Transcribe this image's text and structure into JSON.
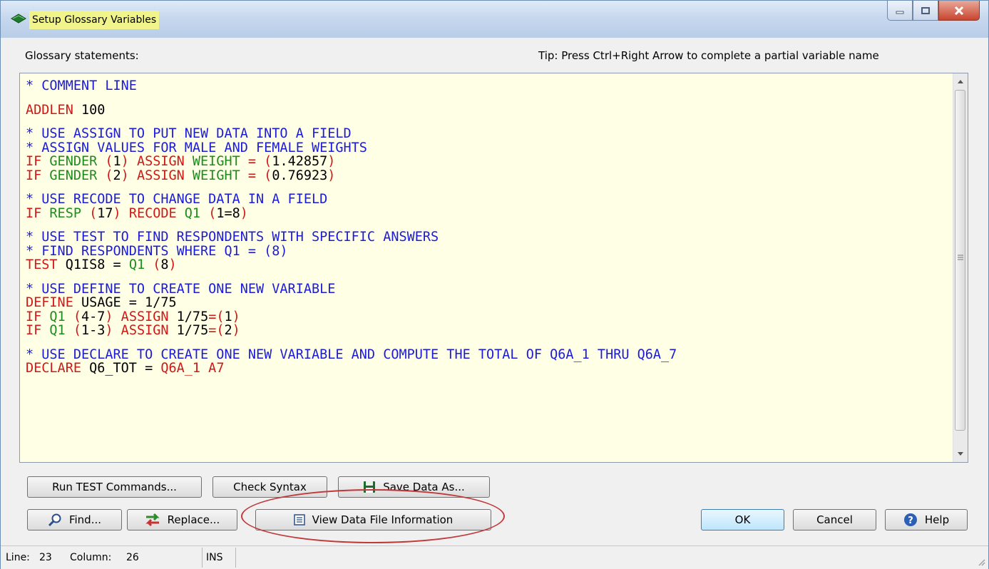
{
  "window": {
    "title": "Setup Glossary Variables",
    "title_highlight_color": "#f0f48a"
  },
  "labels": {
    "statements": "Glossary statements:",
    "tip": "Tip: Press Ctrl+Right Arrow to complete a partial variable name"
  },
  "code": {
    "lines": [
      [
        {
          "t": "* COMMENT LINE",
          "s": "c"
        }
      ],
      [],
      [
        {
          "t": "ADDLEN",
          "s": "k"
        },
        {
          "t": " 100",
          "s": "n"
        }
      ],
      [],
      [
        {
          "t": "* USE ASSIGN TO PUT NEW DATA INTO A FIELD",
          "s": "c"
        }
      ],
      [
        {
          "t": "* ASSIGN VALUES FOR MALE AND FEMALE WEIGHTS",
          "s": "c"
        }
      ],
      [
        {
          "t": "IF ",
          "s": "k"
        },
        {
          "t": "GENDER",
          "s": "v"
        },
        {
          "t": " (",
          "s": "k"
        },
        {
          "t": "1",
          "s": "n"
        },
        {
          "t": ") ASSIGN ",
          "s": "k"
        },
        {
          "t": "WEIGHT",
          "s": "v"
        },
        {
          "t": " = (",
          "s": "k"
        },
        {
          "t": "1.42857",
          "s": "n"
        },
        {
          "t": ")",
          "s": "k"
        }
      ],
      [
        {
          "t": "IF ",
          "s": "k"
        },
        {
          "t": "GENDER",
          "s": "v"
        },
        {
          "t": " (",
          "s": "k"
        },
        {
          "t": "2",
          "s": "n"
        },
        {
          "t": ") ASSIGN ",
          "s": "k"
        },
        {
          "t": "WEIGHT",
          "s": "v"
        },
        {
          "t": " = (",
          "s": "k"
        },
        {
          "t": "0.76923",
          "s": "n"
        },
        {
          "t": ")",
          "s": "k"
        }
      ],
      [],
      [
        {
          "t": "* USE RECODE TO CHANGE DATA IN A FIELD",
          "s": "c"
        }
      ],
      [
        {
          "t": "IF ",
          "s": "k"
        },
        {
          "t": "RESP",
          "s": "v"
        },
        {
          "t": " (",
          "s": "k"
        },
        {
          "t": "17",
          "s": "n"
        },
        {
          "t": ") RECODE ",
          "s": "k"
        },
        {
          "t": "Q1",
          "s": "v"
        },
        {
          "t": " (",
          "s": "k"
        },
        {
          "t": "1=8",
          "s": "n"
        },
        {
          "t": ")",
          "s": "k"
        }
      ],
      [],
      [
        {
          "t": "* USE TEST TO FIND RESPONDENTS WITH SPECIFIC ANSWERS",
          "s": "c"
        }
      ],
      [
        {
          "t": "* FIND RESPONDENTS WHERE Q1 = (8)",
          "s": "c"
        }
      ],
      [
        {
          "t": "TEST ",
          "s": "k"
        },
        {
          "t": "Q1IS8 = ",
          "s": "n"
        },
        {
          "t": "Q1",
          "s": "v"
        },
        {
          "t": " (",
          "s": "k"
        },
        {
          "t": "8",
          "s": "n"
        },
        {
          "t": ")",
          "s": "k"
        }
      ],
      [],
      [
        {
          "t": "* USE DEFINE TO CREATE ONE NEW VARIABLE",
          "s": "c"
        }
      ],
      [
        {
          "t": "DEFINE ",
          "s": "k"
        },
        {
          "t": "USAGE = 1/75",
          "s": "n"
        }
      ],
      [
        {
          "t": "IF ",
          "s": "k"
        },
        {
          "t": "Q1",
          "s": "v"
        },
        {
          "t": " (",
          "s": "k"
        },
        {
          "t": "4-7",
          "s": "n"
        },
        {
          "t": ") ASSIGN ",
          "s": "k"
        },
        {
          "t": "1/75",
          "s": "n"
        },
        {
          "t": "=(",
          "s": "k"
        },
        {
          "t": "1",
          "s": "n"
        },
        {
          "t": ")",
          "s": "k"
        }
      ],
      [
        {
          "t": "IF ",
          "s": "k"
        },
        {
          "t": "Q1",
          "s": "v"
        },
        {
          "t": " (",
          "s": "k"
        },
        {
          "t": "1-3",
          "s": "n"
        },
        {
          "t": ") ASSIGN ",
          "s": "k"
        },
        {
          "t": "1/75",
          "s": "n"
        },
        {
          "t": "=(",
          "s": "k"
        },
        {
          "t": "2",
          "s": "n"
        },
        {
          "t": ")",
          "s": "k"
        }
      ],
      [],
      [
        {
          "t": "* USE DECLARE TO CREATE ONE NEW VARIABLE AND COMPUTE THE TOTAL OF Q6A_1 THRU Q6A_7",
          "s": "c"
        }
      ],
      [
        {
          "t": "DECLARE ",
          "s": "k"
        },
        {
          "t": "Q6_TOT = ",
          "s": "n"
        },
        {
          "t": "Q6A_1 A7",
          "s": "k"
        }
      ]
    ]
  },
  "buttons": {
    "run_test": "Run TEST Commands...",
    "check_syntax": "Check Syntax",
    "save_data_as": "Save Data As...",
    "find": "Find...",
    "replace": "Replace...",
    "view_data_file_info": "View Data File Information",
    "ok": "OK",
    "cancel": "Cancel",
    "help": "Help"
  },
  "status": {
    "line_label": "Line:",
    "line_value": "23",
    "column_label": "Column:",
    "column_value": "26",
    "mode": "INS"
  },
  "colors": {
    "comment": "#1c1cd6",
    "keyword": "#d01818",
    "variable": "#1c8c1c",
    "editor_bg": "#ffffe6",
    "annotation": "#c0393b"
  }
}
